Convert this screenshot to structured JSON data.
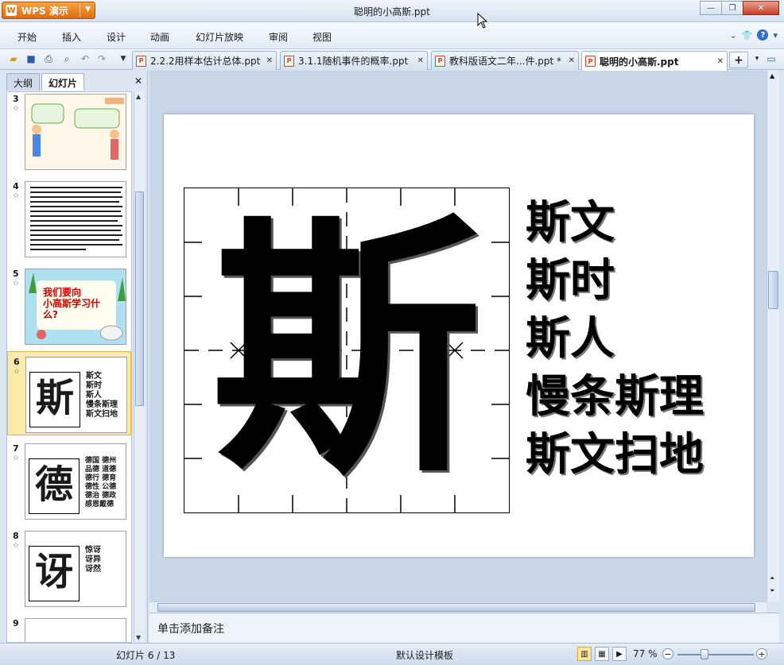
{
  "app": {
    "name": "WPS 演示",
    "title": "聪明的小高斯.ppt"
  },
  "menu": [
    "开始",
    "插入",
    "设计",
    "动画",
    "幻灯片放映",
    "审阅",
    "视图"
  ],
  "tabs": [
    {
      "label": "2.2.2用样本估计总体.ppt *"
    },
    {
      "label": "3.1.1随机事件的概率.ppt"
    },
    {
      "label": "教科版语文二年...件.ppt *"
    },
    {
      "label": "聪明的小高斯.ppt"
    }
  ],
  "panel": {
    "tab_outline": "大纲",
    "tab_slides": "幻灯片"
  },
  "thumbs": [
    {
      "num": "3"
    },
    {
      "num": "4"
    },
    {
      "num": "5",
      "text": "我们要向\n小高斯学习什\n么?"
    },
    {
      "num": "6",
      "char": "斯",
      "words": "斯文\n斯时\n斯人\n慢条斯理\n斯文扫地"
    },
    {
      "num": "7",
      "char": "德",
      "words": "德国 德州\n品德 道德\n德行 德育\n德性 公德\n德治 德政\n感恩戴德"
    },
    {
      "num": "8",
      "char": "讶",
      "words": "惊讶\n讶异\n讶然"
    },
    {
      "num": "9"
    }
  ],
  "slide": {
    "char": "斯",
    "words": [
      "斯文",
      "斯时",
      "斯人",
      "慢条斯理",
      "斯文扫地"
    ]
  },
  "notes_placeholder": "单击添加备注",
  "status": {
    "slide_info": "幻灯片 6 / 13",
    "template": "默认设计模板",
    "zoom": "77 %"
  },
  "colors": {
    "accent": "#e36b0a",
    "selected": "#fbeaa8"
  }
}
